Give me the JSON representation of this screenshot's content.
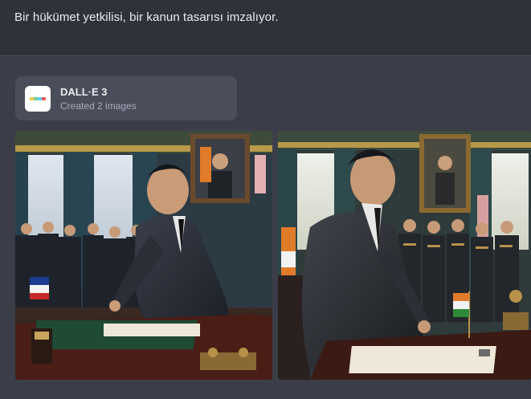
{
  "prompt": {
    "text": "Bir hükümet yetkilisi, bir kanun tasarısı imzalıyor."
  },
  "tool_card": {
    "title": "DALL·E 3",
    "subtitle": "Created 2 images",
    "icon": "dalle-icon"
  },
  "images": [
    {
      "name": "generated-image-1",
      "icon": "image"
    },
    {
      "name": "generated-image-2",
      "icon": "image"
    }
  ],
  "colors": {
    "background": "#353841",
    "card": "#4a4e5a",
    "text": "#ececf1",
    "subtext": "#acacbe"
  }
}
